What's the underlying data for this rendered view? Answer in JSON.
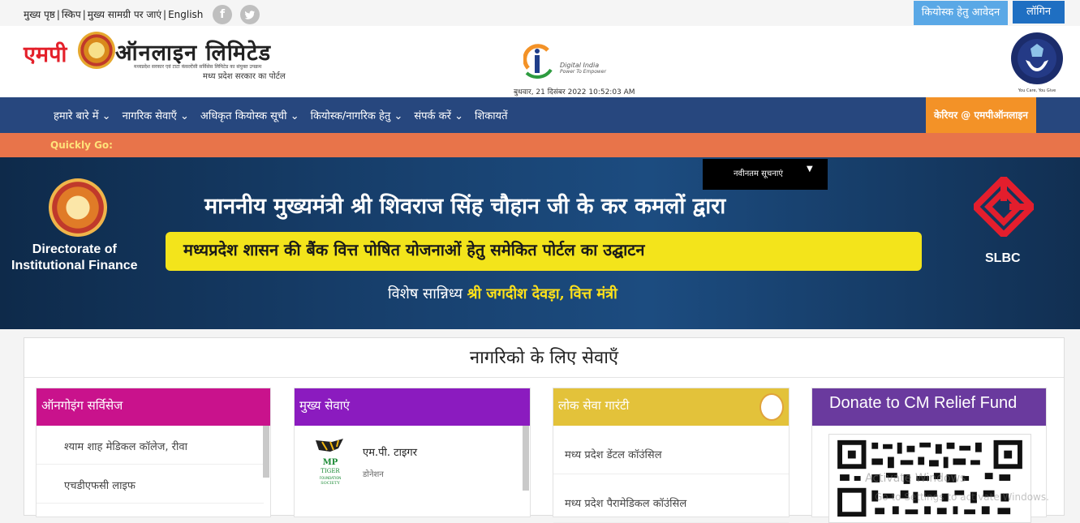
{
  "topbar": {
    "links": [
      "मुख्य पृष्ठ",
      "स्किप",
      "मुख्य सामग्री पर जाएं",
      "English"
    ],
    "social_icons": [
      "facebook-icon",
      "twitter-icon"
    ],
    "kiosk_button": "कियोस्क हेतु आवेदन",
    "login_button": "लॉगिन"
  },
  "header": {
    "logo_red": "एमपी",
    "logo_dark": "ऑनलाइन लिमिटेड",
    "logo_small": "मध्यप्रदेश सरकार एवं टाटा कंसल्टेंसी सर्विसेस लिमिटेड का संयुक्त उपक्रम",
    "logo_sub": "मध्य प्रदेश सरकार का पोर्टल",
    "digital_india": "Digital India",
    "digital_india_tag": "Power To Empower",
    "datetime": "बुधवार, 21 दिसंबर 2022 10:52:03 AM",
    "seal_caption": "You Care, You Give"
  },
  "nav": {
    "items": [
      "हमारे बारे में",
      "नागरिक सेवाएँ",
      "अधिकृत कियोस्क सूची",
      "कियोस्क/नागरिक हेतु",
      "संपर्क करें",
      "शिकायतें"
    ],
    "career": "केरियर @ एमपीऑनलाइन"
  },
  "quick": {
    "label": "Quickly Go:"
  },
  "banner": {
    "left_org_line1": "Directorate of",
    "left_org_line2": "Institutional Finance",
    "headline": "माननीय मुख्यमंत्री श्री शिवराज सिंह चौहान जी के कर कमलों द्वारा",
    "yellow_text": "मध्यप्रदेश शासन की बैंक वित्त पोषित योजनाओं हेतु समेकित पोर्टल का उद्घाटन",
    "special_prefix": "विशेष सान्निध्य",
    "special_name": "श्री जगदीश देवड़ा, वित्त मंत्री",
    "right_org": "SLBC",
    "news_label": "नवीनतम सूचनाएं",
    "news_arrow": "▼"
  },
  "content": {
    "title": "नागरिको के लिए सेवाएँ"
  },
  "cards": {
    "ongoing": {
      "title": "ऑनगोइंग सर्विसेज",
      "items": [
        "श्याम शाह मेडिकल कॉलेज, रीवा",
        "एचडीएफसी लाइफ"
      ]
    },
    "main": {
      "title": "मुख्य सेवाएं",
      "item_title": "एम.पी. टाइगर",
      "item_sub": "डोनेशन",
      "logo_text": "MP TIGER FOUNDATION SOCIETY"
    },
    "lsg": {
      "title": "लोक सेवा गारंटी",
      "items": [
        "मध्य प्रदेश डेंटल कॉउंसिल",
        "मध्य प्रदेश पैरामेडिकल कॉउंसिल"
      ]
    },
    "relief": {
      "title": "Donate to CM Relief Fund"
    }
  },
  "watermark": {
    "line1": "Activate Windows",
    "line2": "Go to Settings to activate Windows."
  }
}
